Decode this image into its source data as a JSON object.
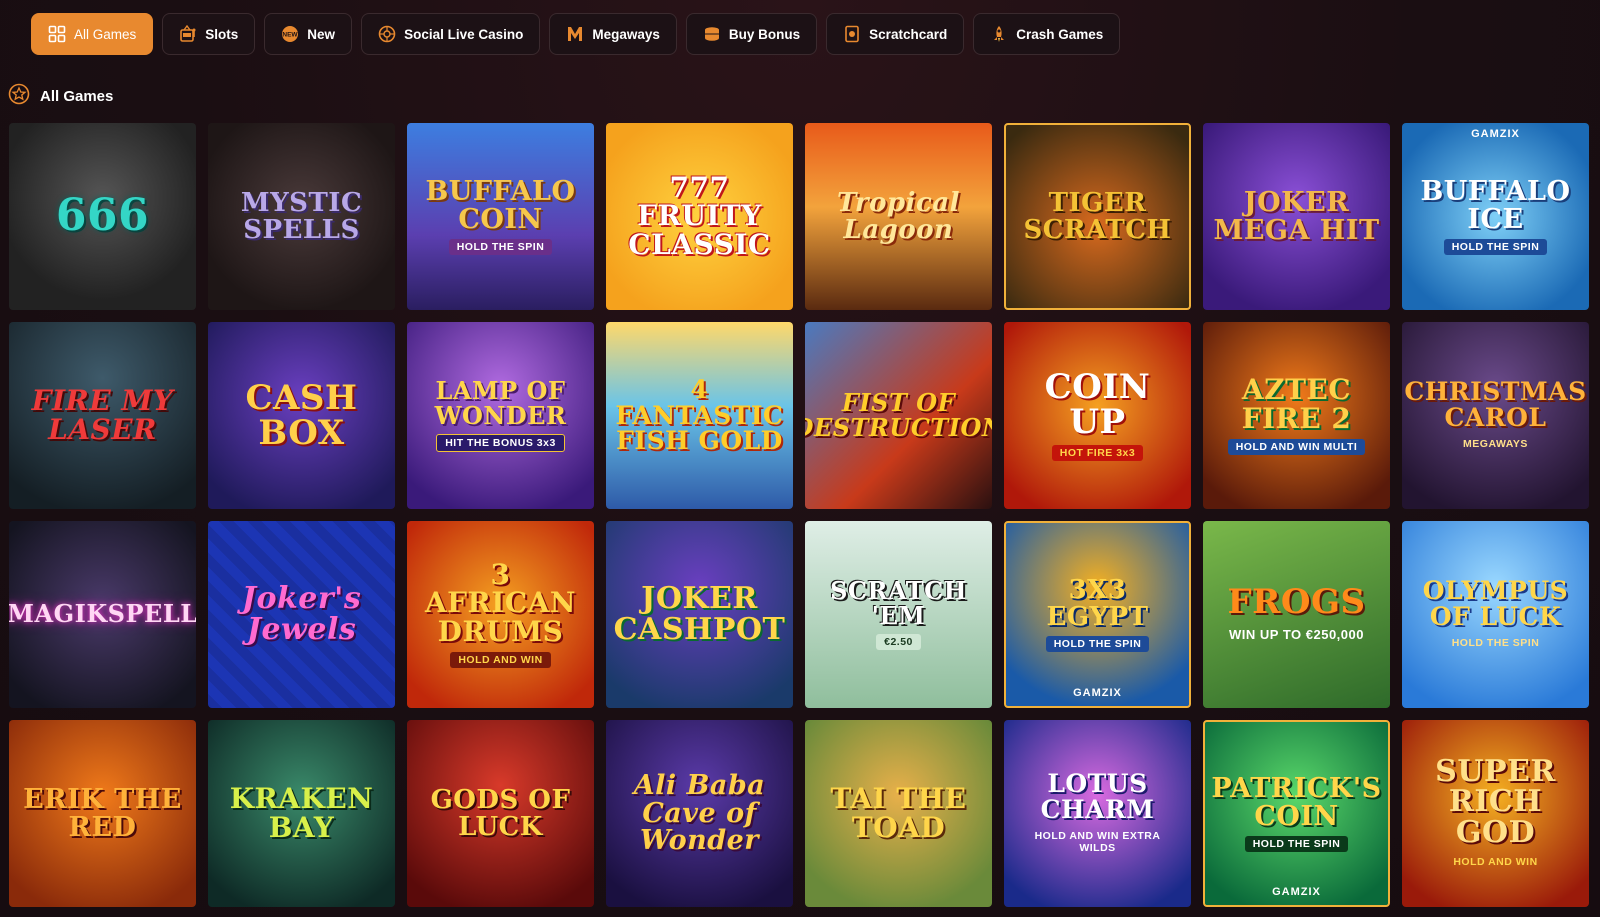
{
  "tabs": [
    {
      "label": "All Games",
      "icon": "grid-icon",
      "active": true
    },
    {
      "label": "Slots",
      "icon": "slot-machine-icon",
      "active": false
    },
    {
      "label": "New",
      "icon": "new-badge-icon",
      "active": false
    },
    {
      "label": "Social Live Casino",
      "icon": "roulette-icon",
      "active": false
    },
    {
      "label": "Megaways",
      "icon": "megaways-m-icon",
      "active": false
    },
    {
      "label": "Buy Bonus",
      "icon": "coin-stack-icon",
      "active": false
    },
    {
      "label": "Scratchcard",
      "icon": "scratchcard-icon",
      "active": false
    },
    {
      "label": "Crash Games",
      "icon": "rocket-icon",
      "active": false
    }
  ],
  "section": {
    "title": "All Games",
    "icon": "star-badge-icon"
  },
  "games": [
    {
      "title": "666",
      "sub": "",
      "brand": ""
    },
    {
      "title": "Mystic Spells",
      "sub": "",
      "brand": ""
    },
    {
      "title": "Buffalo Coin",
      "sub": "HOLD THE SPIN",
      "brand": ""
    },
    {
      "title": "777 Fruity Classic",
      "sub": "",
      "brand": ""
    },
    {
      "title": "Tropical Lagoon",
      "sub": "",
      "brand": ""
    },
    {
      "title": "Tiger Scratch",
      "sub": "",
      "brand": ""
    },
    {
      "title": "Joker Mega Hit",
      "sub": "",
      "brand": ""
    },
    {
      "title": "Buffalo Ice",
      "sub": "HOLD THE SPIN",
      "brand": "GAMZIX"
    },
    {
      "title": "Fire My Laser",
      "sub": "",
      "brand": ""
    },
    {
      "title": "Cash Box",
      "sub": "",
      "brand": ""
    },
    {
      "title": "Lamp of Wonder",
      "sub": "HIT THE BONUS 3x3",
      "brand": ""
    },
    {
      "title": "4 Fantastic Fish Gold",
      "sub": "",
      "brand": ""
    },
    {
      "title": "Fist of Destruction",
      "sub": "",
      "brand": ""
    },
    {
      "title": "Coin Up",
      "sub": "HOT FIRE 3x3",
      "brand": ""
    },
    {
      "title": "Aztec Fire 2",
      "sub": "HOLD AND WIN MULTI",
      "brand": ""
    },
    {
      "title": "Christmas Carol",
      "sub": "MEGAWAYS",
      "brand": ""
    },
    {
      "title": "Magikspell",
      "sub": "",
      "brand": ""
    },
    {
      "title": "Joker's Jewels",
      "sub": "",
      "brand": ""
    },
    {
      "title": "3 African Drums",
      "sub": "HOLD AND WIN",
      "brand": ""
    },
    {
      "title": "Joker Cashpot",
      "sub": "",
      "brand": ""
    },
    {
      "title": "Scratch 'Em",
      "sub": "€2.50",
      "brand": ""
    },
    {
      "title": "3x3 Egypt",
      "sub": "HOLD THE SPIN",
      "brand": "GAMZIX"
    },
    {
      "title": "Frogs",
      "sub": "WIN UP TO €250,000",
      "brand": ""
    },
    {
      "title": "Olympus of Luck",
      "sub": "HOLD THE SPIN",
      "brand": ""
    },
    {
      "title": "Erik the Red",
      "sub": "",
      "brand": ""
    },
    {
      "title": "Kraken Bay",
      "sub": "",
      "brand": ""
    },
    {
      "title": "Gods of Luck",
      "sub": "",
      "brand": ""
    },
    {
      "title": "Ali Baba Cave of Wonder",
      "sub": "",
      "brand": ""
    },
    {
      "title": "Tai the Toad",
      "sub": "",
      "brand": ""
    },
    {
      "title": "Lotus Charm",
      "sub": "HOLD AND WIN EXTRA WILDS",
      "brand": ""
    },
    {
      "title": "Patrick's Coin",
      "sub": "HOLD THE SPIN",
      "brand": "GAMZIX"
    },
    {
      "title": "Super Rich God",
      "sub": "HOLD AND WIN",
      "brand": ""
    }
  ],
  "colors": {
    "accent": "#e8892f",
    "background": "#1a0e12",
    "tab_border": "#3a2a2e"
  }
}
